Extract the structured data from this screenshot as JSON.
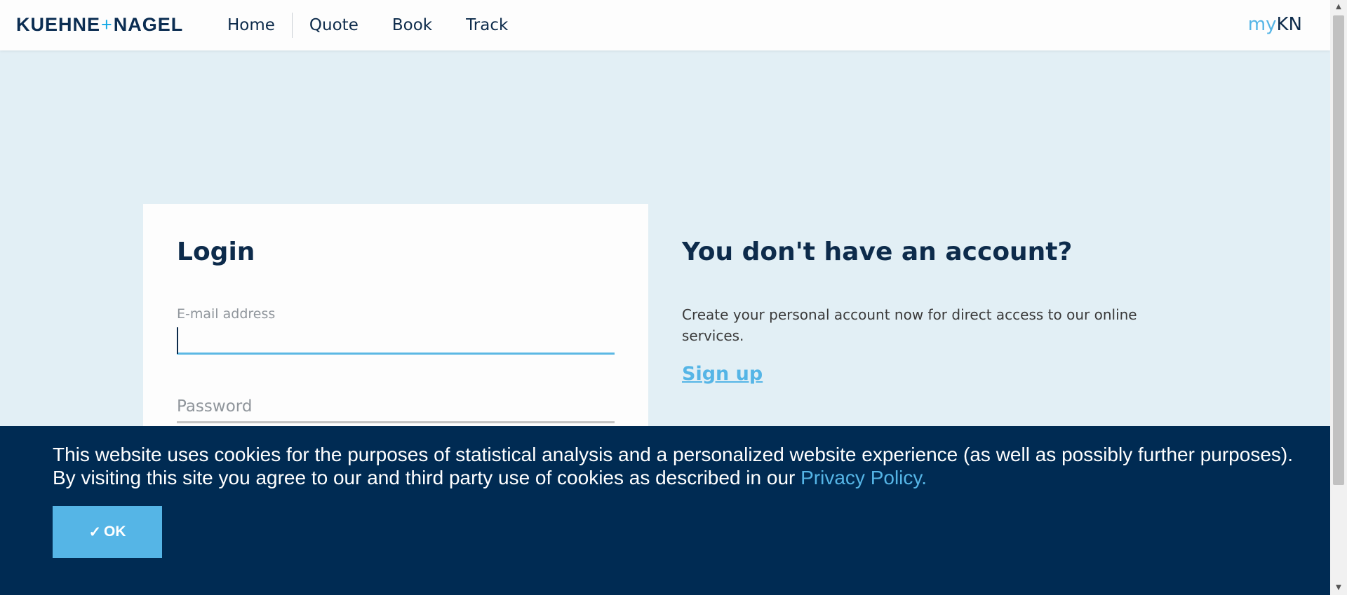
{
  "header": {
    "logo_left": "KUEHNE",
    "logo_plus": "+",
    "logo_right": "NAGEL",
    "nav": [
      "Home",
      "Quote",
      "Book",
      "Track"
    ],
    "mykn_my": "my",
    "mykn_kn": "KN"
  },
  "login": {
    "title": "Login",
    "email_label": "E-mail address",
    "email_value": "",
    "password_placeholder": "Password"
  },
  "signup": {
    "title": "You don't have an account?",
    "text": "Create your personal account now for direct access to our online services.",
    "link": "Sign up"
  },
  "cookie": {
    "text": "This website uses cookies for the purposes of statistical analysis and a personalized website experience (as well as possibly further purposes). By visiting this site you agree to our and third party use of cookies as described in our",
    "link": "Privacy Policy.",
    "ok_icon": "✓",
    "ok_label": "OK"
  },
  "colors": {
    "brand_dark": "#002b53",
    "accent": "#55b5e6",
    "page_bg": "#e2eff5"
  }
}
